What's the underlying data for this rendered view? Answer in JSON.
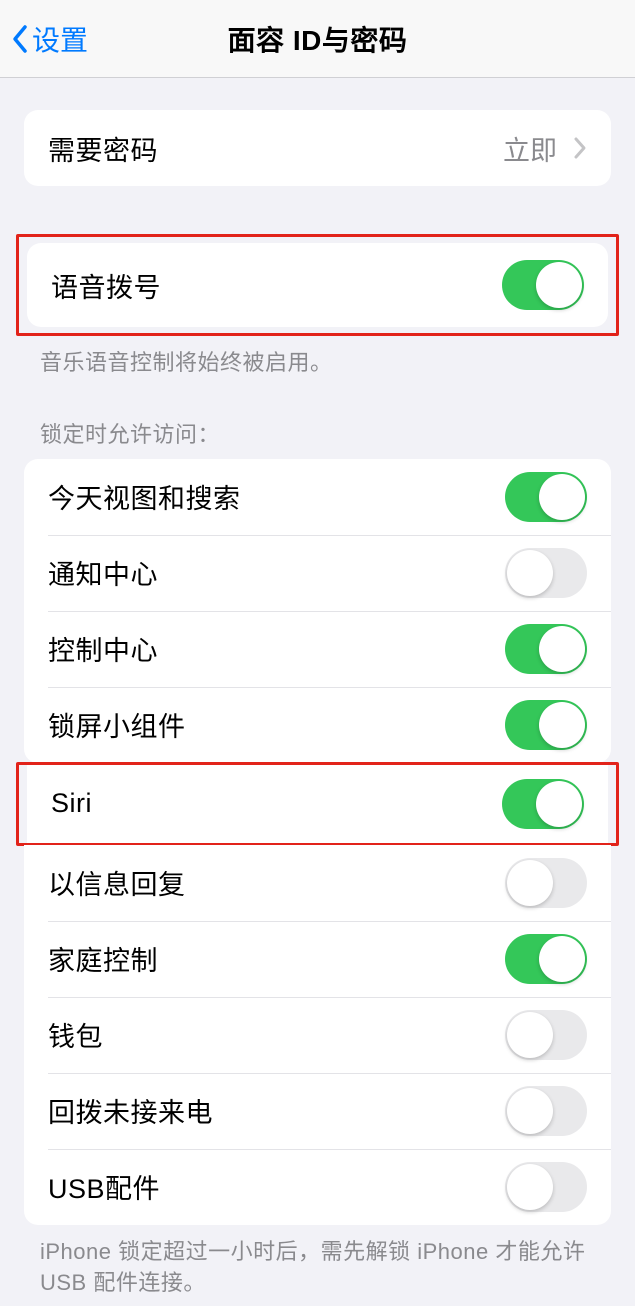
{
  "nav": {
    "back_label": "设置",
    "title": "面容 ID与密码"
  },
  "passcode": {
    "label": "需要密码",
    "value": "立即"
  },
  "voice_dial": {
    "label": "语音拨号",
    "enabled": true,
    "footer": "音乐语音控制将始终被启用。"
  },
  "lock_access": {
    "header": "锁定时允许访问：",
    "items": [
      {
        "label": "今天视图和搜索",
        "enabled": true
      },
      {
        "label": "通知中心",
        "enabled": false
      },
      {
        "label": "控制中心",
        "enabled": true
      },
      {
        "label": "锁屏小组件",
        "enabled": true
      },
      {
        "label": "Siri",
        "enabled": true
      },
      {
        "label": "以信息回复",
        "enabled": false
      },
      {
        "label": "家庭控制",
        "enabled": true
      },
      {
        "label": "钱包",
        "enabled": false
      },
      {
        "label": "回拨未接来电",
        "enabled": false
      },
      {
        "label": "USB配件",
        "enabled": false
      }
    ],
    "footer": "iPhone 锁定超过一小时后，需先解锁 iPhone 才能允许USB 配件连接。"
  }
}
